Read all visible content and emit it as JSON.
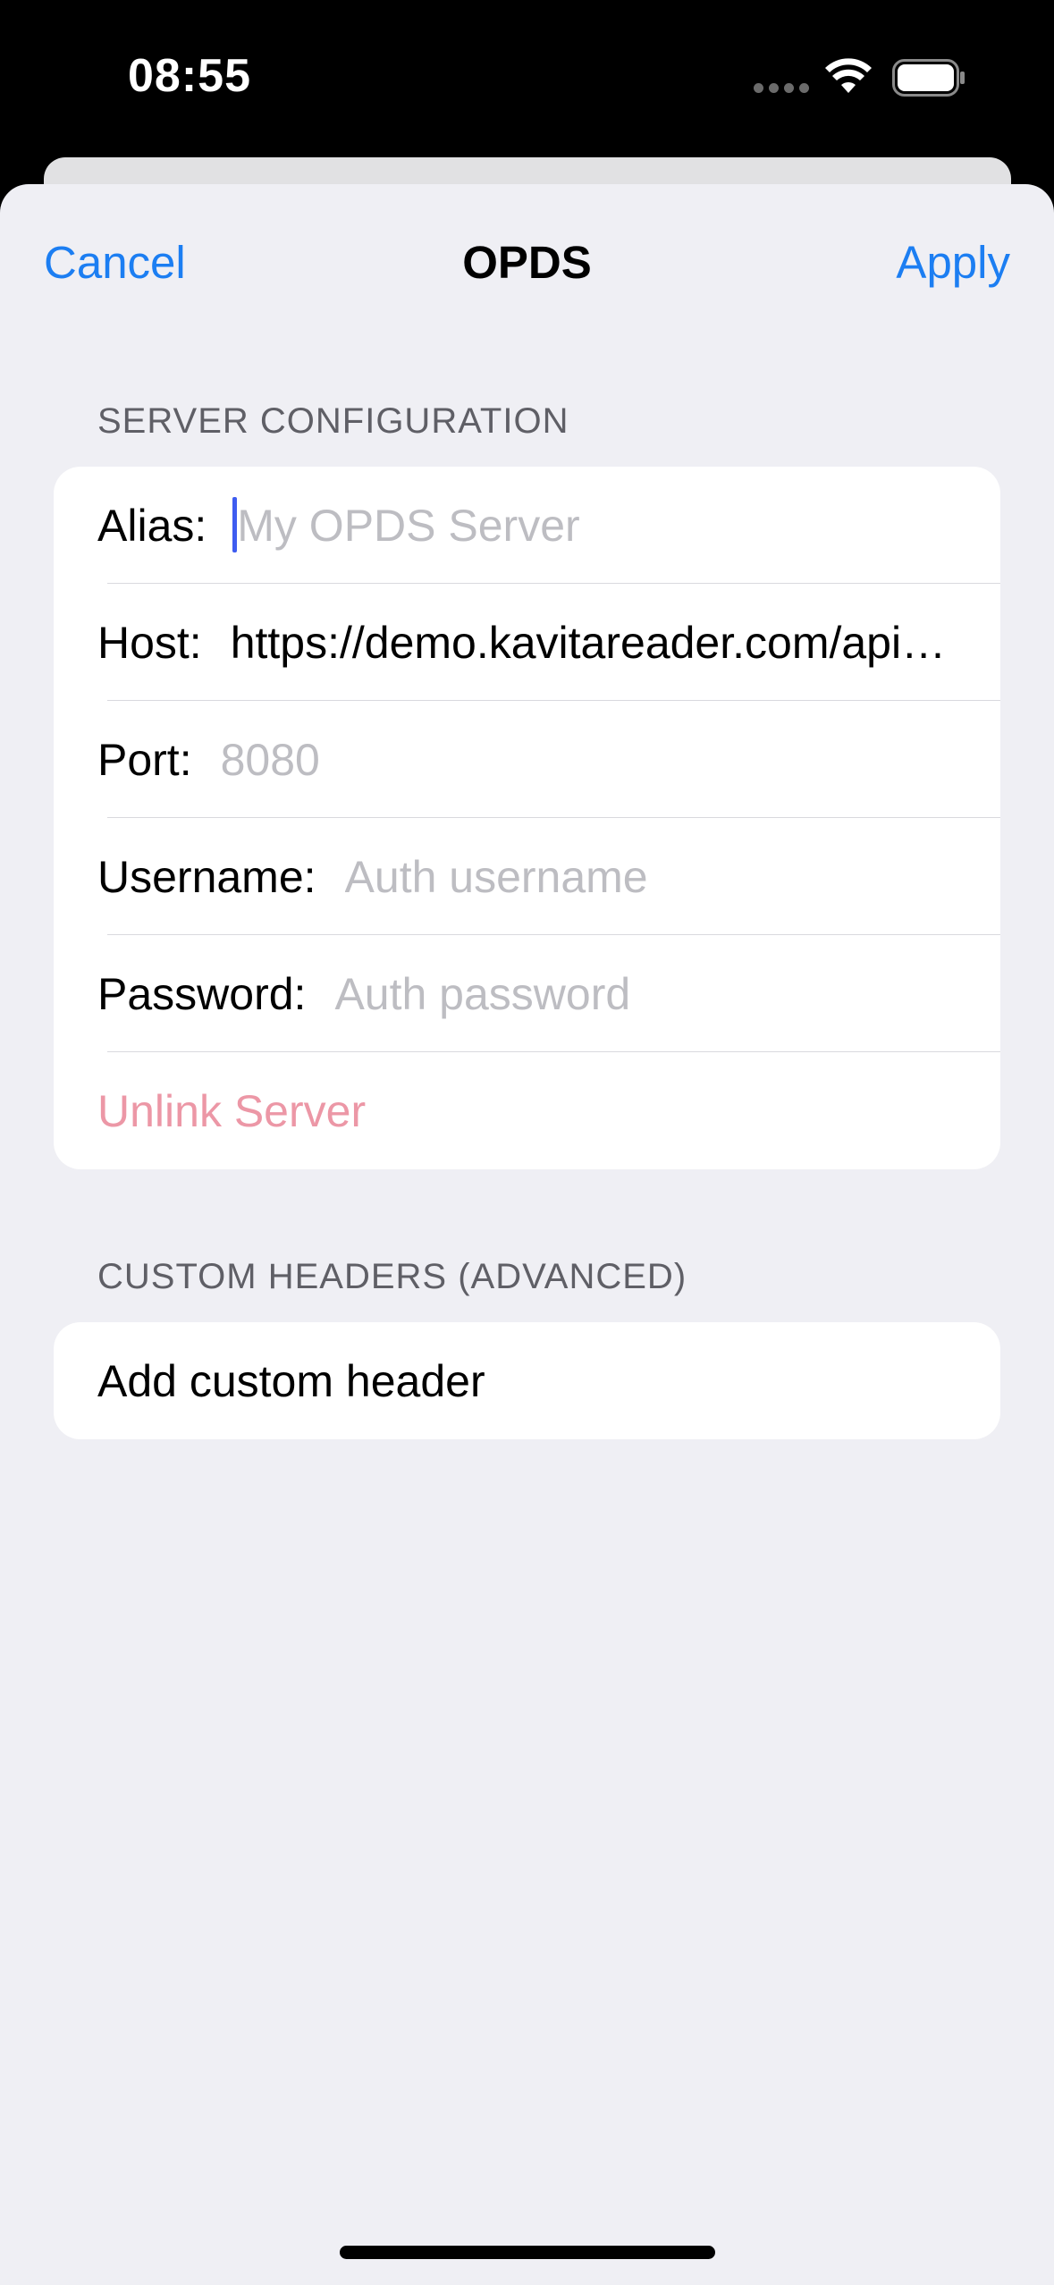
{
  "status_bar": {
    "time": "08:55",
    "icons": [
      "cellular-signal-icon",
      "wifi-icon",
      "battery-icon"
    ]
  },
  "nav": {
    "cancel_label": "Cancel",
    "title": "OPDS",
    "apply_label": "Apply"
  },
  "server_section": {
    "header": "SERVER CONFIGURATION",
    "alias": {
      "label": "Alias:",
      "value": "",
      "placeholder": "My OPDS Server"
    },
    "host": {
      "label": "Host:",
      "value": "https://demo.kavitareader.com/api/opds/...",
      "display": "https://demo.kavitareader.com/api/o..."
    },
    "port": {
      "label": "Port:",
      "value": "",
      "placeholder": "8080"
    },
    "username": {
      "label": "Username:",
      "value": "",
      "placeholder": "Auth username"
    },
    "password": {
      "label": "Password:",
      "value": "",
      "placeholder": "Auth password"
    },
    "unlink_label": "Unlink Server"
  },
  "headers_section": {
    "header": "CUSTOM HEADERS (ADVANCED)",
    "add_label": "Add custom header"
  },
  "colors": {
    "accent": "#1c7ef2",
    "destructive_disabled": "#ec97a6",
    "background": "#efeff4"
  }
}
